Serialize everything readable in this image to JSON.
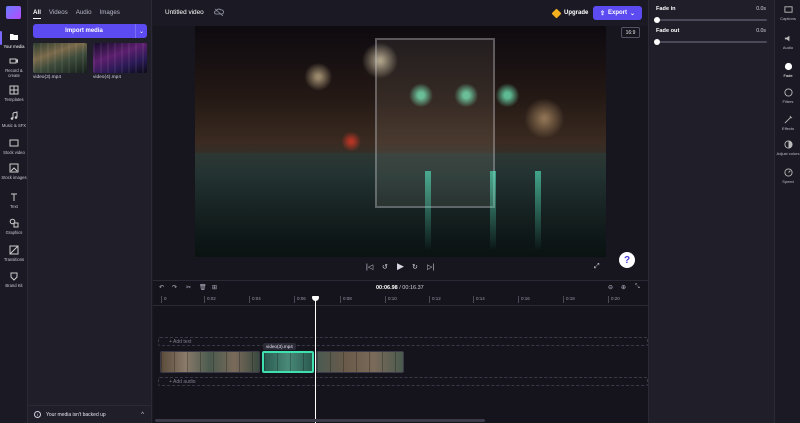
{
  "left_rail": {
    "items": [
      {
        "label": "Your media",
        "icon": "folder-icon"
      },
      {
        "label": "Record & create",
        "icon": "camera-icon"
      },
      {
        "label": "Templates",
        "icon": "grid-icon"
      },
      {
        "label": "Music & SFX",
        "icon": "music-icon"
      },
      {
        "label": "Stock video",
        "icon": "film-icon"
      },
      {
        "label": "Stock images",
        "icon": "image-icon"
      },
      {
        "label": "Text",
        "icon": "text-icon"
      },
      {
        "label": "Graphics",
        "icon": "shapes-icon"
      },
      {
        "label": "Transitions",
        "icon": "transition-icon"
      },
      {
        "label": "Brand Kit",
        "icon": "brand-icon"
      }
    ]
  },
  "media_panel": {
    "tabs": [
      "All",
      "Videos",
      "Audio",
      "Images"
    ],
    "import_label": "Import media",
    "files": [
      {
        "name": "video(3).mp4"
      },
      {
        "name": "video(4).mp4"
      }
    ],
    "backup_text": "Your media isn't backed up"
  },
  "topbar": {
    "project_title": "Untitled video",
    "upgrade_label": "Upgrade",
    "export_label": "Export"
  },
  "preview": {
    "aspect": "16:9"
  },
  "timeline": {
    "current_time": "00:06.98",
    "total_time": "/ 00:16.37",
    "ticks": [
      "0",
      "0:02",
      "0:04",
      "0:06",
      "0:08",
      "0:10",
      "0:12",
      "0:14",
      "0:16",
      "0:18",
      "0:20"
    ],
    "add_text_label": "+ Add text",
    "add_audio_label": "+ Add audio",
    "clip_label": "video(3).mp4"
  },
  "properties": {
    "fade_in_label": "Fade in",
    "fade_in_value": "0.0s",
    "fade_in_level": 0,
    "fade_out_label": "Fade out",
    "fade_out_value": "0.0s",
    "fade_out_level": 0
  },
  "right_rail": {
    "items": [
      {
        "label": "Captions",
        "icon": "captions-icon"
      },
      {
        "label": "Audio",
        "icon": "speaker-icon"
      },
      {
        "label": "Fade",
        "icon": "fade-icon"
      },
      {
        "label": "Filters",
        "icon": "filters-icon"
      },
      {
        "label": "Effects",
        "icon": "effects-icon"
      },
      {
        "label": "Adjust colors",
        "icon": "adjust-icon"
      },
      {
        "label": "Speed",
        "icon": "speed-icon"
      }
    ]
  },
  "colors": {
    "accent": "#5b4bf0",
    "selected_clip": "#3ee0b0"
  }
}
